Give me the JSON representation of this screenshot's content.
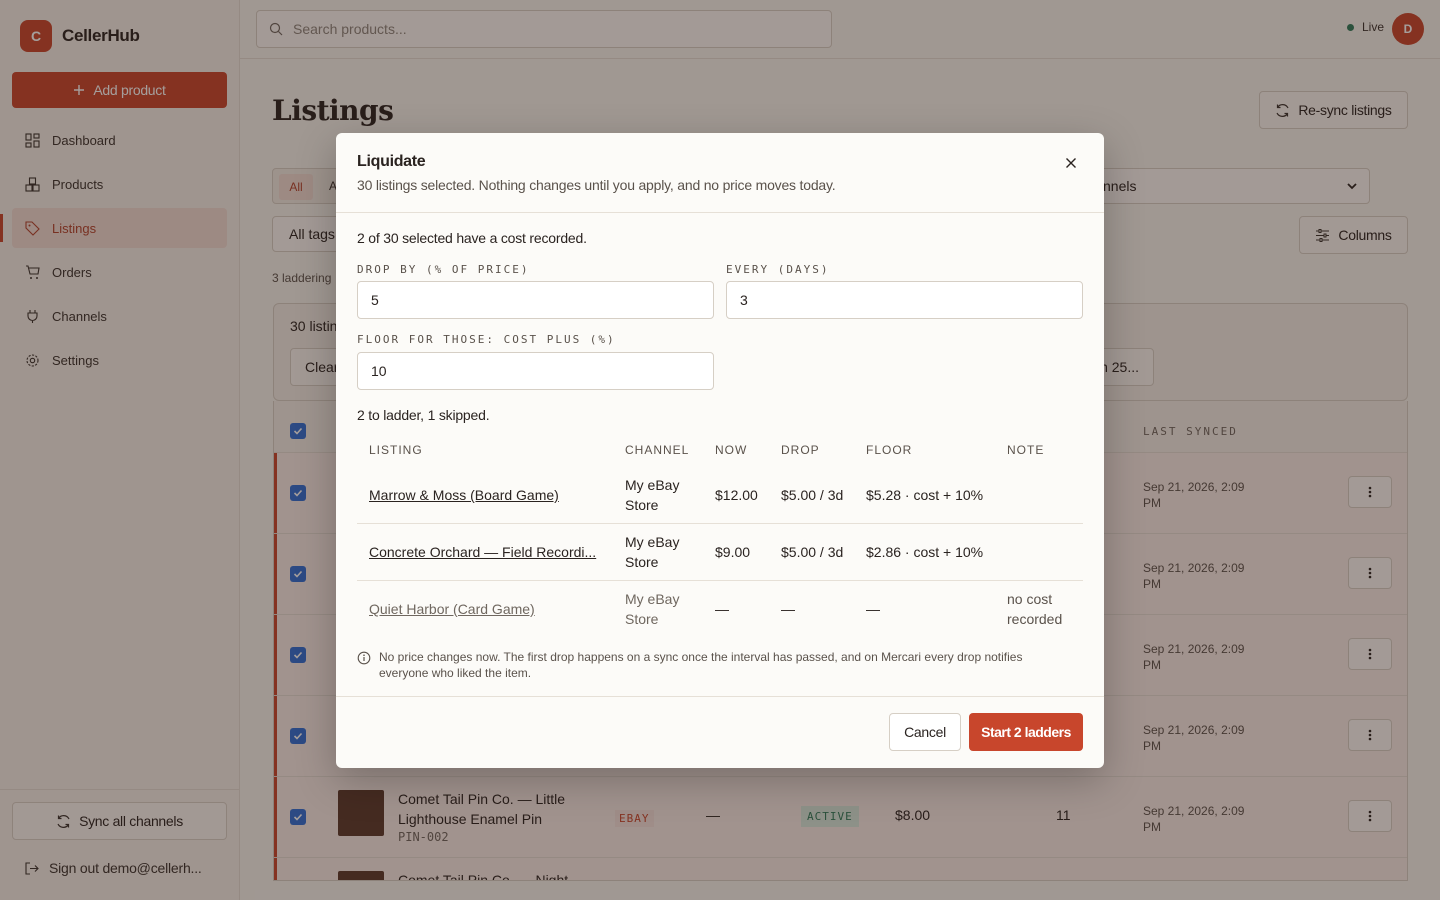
{
  "app": {
    "name": "CellerHub",
    "logo_letter": "C",
    "brand_color": "#c8462c"
  },
  "sidebar": {
    "add_product_label": "Add product",
    "items": [
      {
        "label": "Dashboard",
        "icon": "dashboard-icon"
      },
      {
        "label": "Products",
        "icon": "products-icon"
      },
      {
        "label": "Listings",
        "icon": "tag-icon",
        "active": true
      },
      {
        "label": "Orders",
        "icon": "cart-icon"
      },
      {
        "label": "Channels",
        "icon": "plug-icon"
      },
      {
        "label": "Settings",
        "icon": "gear-icon"
      }
    ],
    "sync_all_label": "Sync all channels",
    "sign_out_label": "Sign out demo@cellerh..."
  },
  "topbar": {
    "search_placeholder": "Search products...",
    "live_label": "Live",
    "live_color": "#2d7a5a",
    "avatar_initial": "D"
  },
  "page": {
    "title": "Listings",
    "resync_label": "Re-sync listings",
    "tab_all": "All",
    "tab_partial": "A",
    "channel_select_value": "nnels",
    "tags_label": "All tags",
    "columns_label": "Columns",
    "laddering_text": "3 laddering",
    "selection_count": "30 listin",
    "clear_label": "Clear",
    "chip_label": "n 25...",
    "col_last_synced": "LAST SYNCED",
    "rows": [
      {
        "synced": "Sep 21, 2026, 2:09 PM"
      },
      {
        "synced": "Sep 21, 2026, 2:09 PM"
      },
      {
        "synced": "Sep 21, 2026, 2:09 PM"
      },
      {
        "synced": "Sep 21, 2026, 2:09 PM"
      },
      {
        "title": "Comet Tail Pin Co. — Little Lighthouse Enamel Pin",
        "sku": "PIN-002",
        "channel": "EBAY",
        "dash": "—",
        "status": "ACTIVE",
        "price": "$8.00",
        "qty": "11",
        "synced": "Sep 21, 2026, 2:09 PM"
      },
      {
        "title": "Comet Tail Pin Co. — Night"
      }
    ]
  },
  "modal": {
    "title": "Liquidate",
    "subtitle": "30 listings selected. Nothing changes until you apply, and no price moves today.",
    "cost_note": "2 of 30 selected have a cost recorded.",
    "drop_by_label": "DROP BY (% OF PRICE)",
    "drop_by_value": "5",
    "every_label": "EVERY (DAYS)",
    "every_value": "3",
    "floor_label": "FLOOR FOR THOSE: COST PLUS (%)",
    "floor_value": "10",
    "ladder_summary": "2 to ladder, 1 skipped.",
    "table_headers": {
      "listing": "LISTING",
      "channel": "CHANNEL",
      "now": "NOW",
      "drop": "DROP",
      "floor": "FLOOR",
      "note": "NOTE"
    },
    "rows": [
      {
        "listing": "Marrow & Moss (Board Game)",
        "channel": "My eBay Store",
        "now": "$12.00",
        "drop": "$5.00 / 3d",
        "floor": "$5.28 · cost + 10%",
        "note": ""
      },
      {
        "listing": "Concrete Orchard — Field Recordi...",
        "channel": "My eBay Store",
        "now": "$9.00",
        "drop": "$5.00 / 3d",
        "floor": "$2.86 · cost + 10%",
        "note": ""
      },
      {
        "listing": "Quiet Harbor (Card Game)",
        "channel": "My eBay Store",
        "now": "—",
        "drop": "—",
        "floor": "—",
        "note": "no cost recorded"
      }
    ],
    "info_text": "No price changes now. The first drop happens on a sync once the interval has passed, and on Mercari every drop notifies everyone who liked the item.",
    "cancel_label": "Cancel",
    "start_label": "Start 2 ladders"
  }
}
